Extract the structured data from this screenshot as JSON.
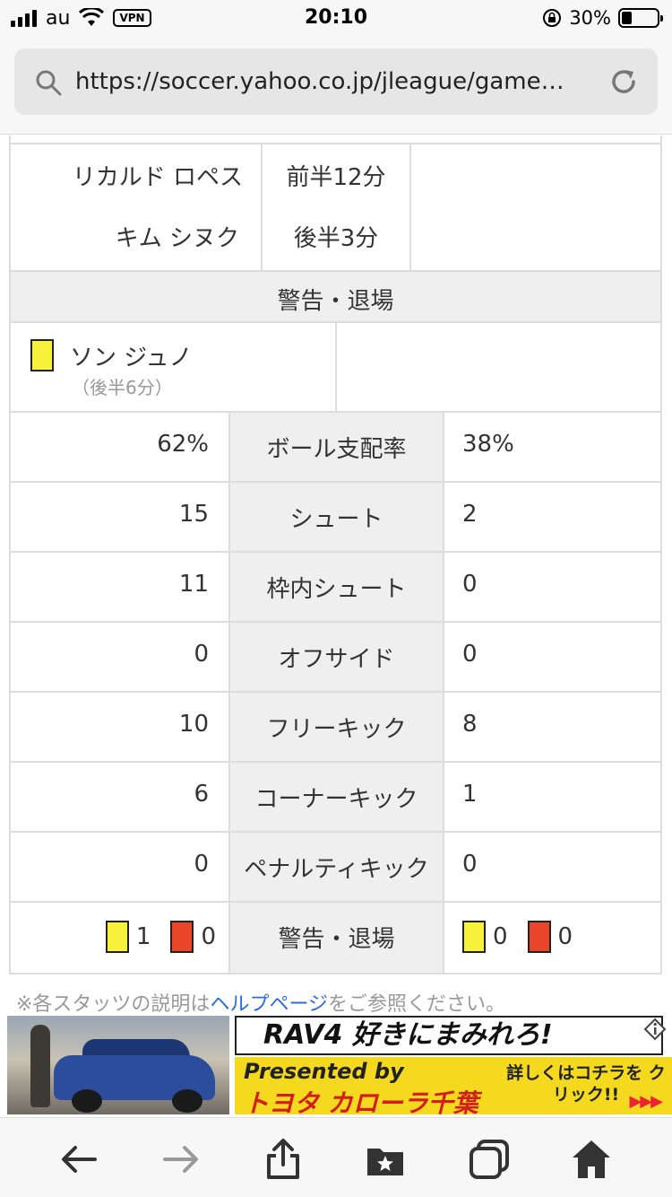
{
  "status_bar": {
    "carrier": "au",
    "vpn": "VPN",
    "time": "20:10",
    "battery_percent_text": "30%",
    "battery_level": 0.3
  },
  "browser": {
    "url": "https://soccer.yahoo.co.jp/jleague/game…"
  },
  "scorers": {
    "rows": [
      {
        "name": "リカルド ロペス",
        "time": "前半12分"
      },
      {
        "name": "キム シヌク",
        "time": "後半3分"
      }
    ]
  },
  "cards_section": {
    "header": "警告・退場",
    "home_player": "ソン ジュノ",
    "home_time": "（後半6分）"
  },
  "stats": {
    "rows": [
      {
        "home": "62%",
        "label": "ボール支配率",
        "away": "38%"
      },
      {
        "home": "15",
        "label": "シュート",
        "away": "2"
      },
      {
        "home": "11",
        "label": "枠内シュート",
        "away": "0"
      },
      {
        "home": "0",
        "label": "オフサイド",
        "away": "0"
      },
      {
        "home": "10",
        "label": "フリーキック",
        "away": "8"
      },
      {
        "home": "6",
        "label": "コーナーキック",
        "away": "1"
      },
      {
        "home": "0",
        "label": "ペナルティキック",
        "away": "0"
      }
    ],
    "cards_row": {
      "label": "警告・退場",
      "home_yellow": "1",
      "home_red": "0",
      "away_yellow": "0",
      "away_red": "0"
    }
  },
  "footnote": {
    "prefix": "※各スタッツの説明は",
    "link": "ヘルプページ",
    "suffix": "をご参照ください。"
  },
  "ad": {
    "title": "RAV4 好きにまみれろ!",
    "presented": "Presented by",
    "dealer": "トヨタ カローラ千葉",
    "cta": "詳しくはコチラを クリック!!",
    "arrows": "▶▶▶"
  },
  "colors": {
    "yellow_card": "#f7f23c",
    "red_card": "#e8452a",
    "link": "#2a6ed8"
  }
}
